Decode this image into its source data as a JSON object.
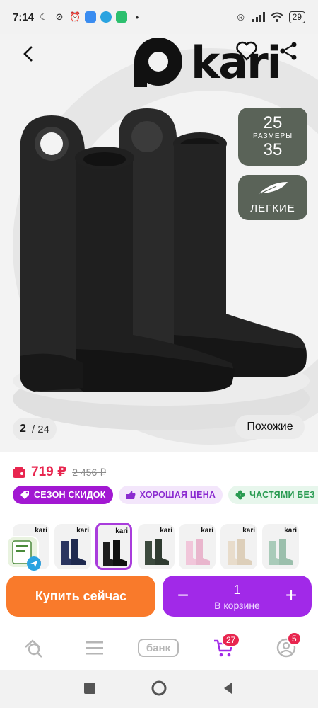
{
  "status_bar": {
    "time": "7:14",
    "battery": "29"
  },
  "brand": {
    "name": "kari"
  },
  "badges": {
    "size_from": "25",
    "size_label": "РАЗМЕРЫ",
    "size_to": "35",
    "light_label": "ЛЕГКИЕ"
  },
  "gallery": {
    "current": "2",
    "total": "/ 24",
    "similar_label": "Похожие"
  },
  "price": {
    "current": "719 ₽",
    "old": "2 456 ₽",
    "color": "#e8264f"
  },
  "chips": [
    {
      "label": "СЕЗОН СКИДОК",
      "icon": "tag-icon"
    },
    {
      "label": "ХОРОШАЯ ЦЕНА",
      "icon": "thumbs-up-icon"
    },
    {
      "label": "ЧАСТЯМИ БЕЗ ПЕРЕП",
      "icon": "clover-icon"
    }
  ],
  "thumbnails": [
    {
      "color": "#c9a4b4",
      "active": false
    },
    {
      "color": "#2a3560",
      "active": false
    },
    {
      "color": "#1e1e1e",
      "active": true
    },
    {
      "color": "#3c4a3e",
      "active": false
    },
    {
      "color": "#f1c6da",
      "active": false
    },
    {
      "color": "#e8dccb",
      "active": false
    },
    {
      "color": "#a9cbb9",
      "active": false
    }
  ],
  "actions": {
    "buy_label": "Купить сейчас",
    "quantity": "1",
    "in_cart_label": "В корзине",
    "buy_color": "#f97a2b",
    "cart_color": "#a129e8"
  },
  "bottom_nav": {
    "bank_label": "банк",
    "cart_count": "27",
    "profile_count": "5"
  }
}
